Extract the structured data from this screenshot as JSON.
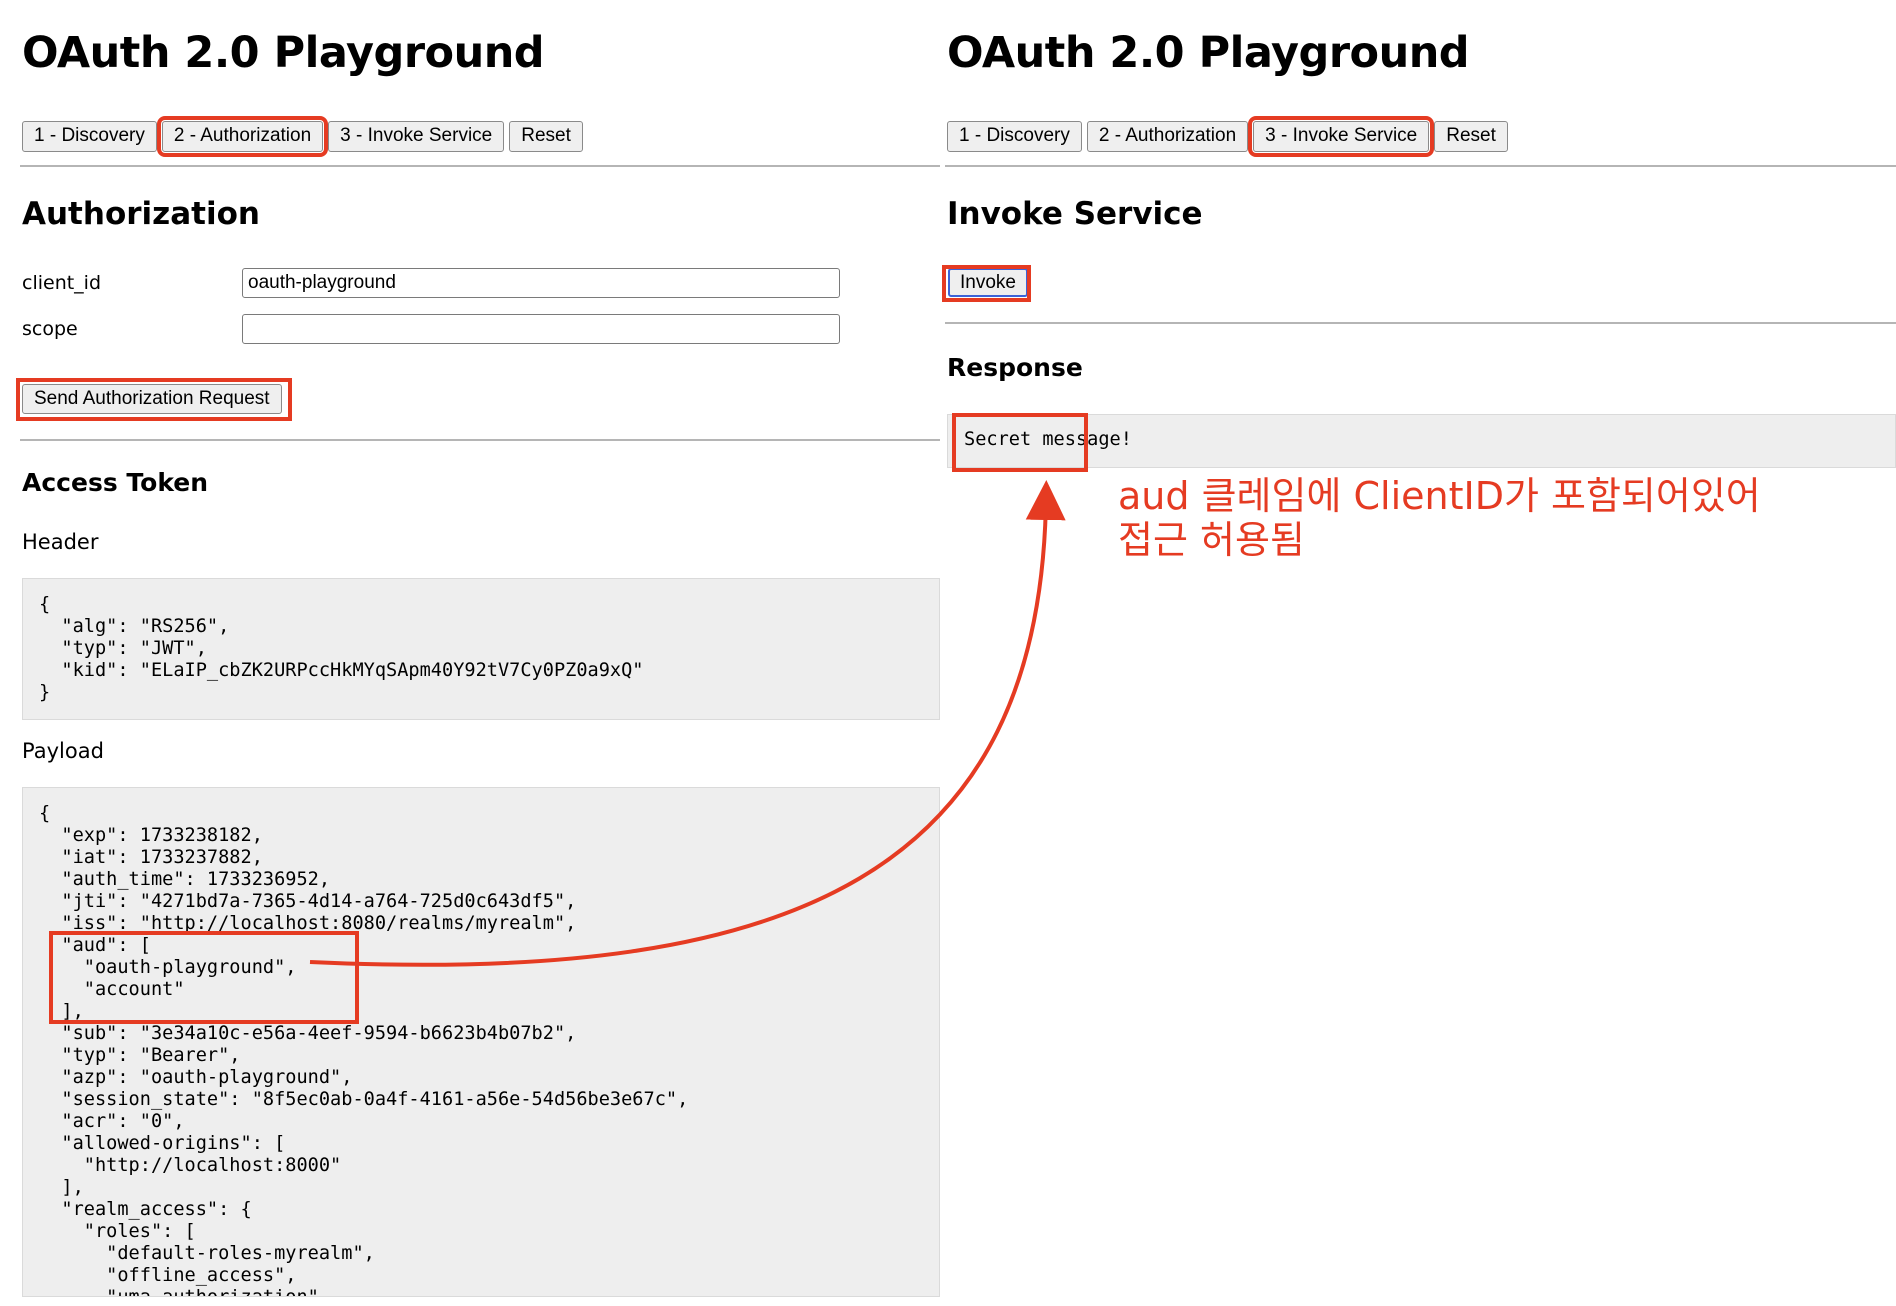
{
  "left": {
    "title": "OAuth 2.0 Playground",
    "tabs": [
      {
        "label": "1 - Discovery",
        "highlighted": false
      },
      {
        "label": "2 - Authorization",
        "highlighted": true
      },
      {
        "label": "3 - Invoke Service",
        "highlighted": false
      },
      {
        "label": "Reset",
        "highlighted": false
      }
    ],
    "section_title": "Authorization",
    "form": {
      "client_id_label": "client_id",
      "client_id_value": "oauth-playground",
      "scope_label": "scope",
      "scope_value": ""
    },
    "send_button_label": "Send Authorization Request",
    "access_token": {
      "title": "Access Token",
      "header_label": "Header",
      "header_json": "{\n  \"alg\": \"RS256\",\n  \"typ\": \"JWT\",\n  \"kid\": \"ELaIP_cbZK2URPccHkMYqSApm40Y92tV7Cy0PZ0a9xQ\"\n}",
      "payload_label": "Payload",
      "payload_json": "{\n  \"exp\": 1733238182,\n  \"iat\": 1733237882,\n  \"auth_time\": 1733236952,\n  \"jti\": \"4271bd7a-7365-4d14-a764-725d0c643df5\",\n  \"iss\": \"http://localhost:8080/realms/myrealm\",\n  \"aud\": [\n    \"oauth-playground\",\n    \"account\"\n  ],\n  \"sub\": \"3e34a10c-e56a-4eef-9594-b6623b4b07b2\",\n  \"typ\": \"Bearer\",\n  \"azp\": \"oauth-playground\",\n  \"session_state\": \"8f5ec0ab-0a4f-4161-a56e-54d56be3e67c\",\n  \"acr\": \"0\",\n  \"allowed-origins\": [\n    \"http://localhost:8000\"\n  ],\n  \"realm_access\": {\n    \"roles\": [\n      \"default-roles-myrealm\",\n      \"offline_access\",\n      \"uma_authorization\""
    }
  },
  "right": {
    "title": "OAuth 2.0 Playground",
    "tabs": [
      {
        "label": "1 - Discovery",
        "highlighted": false
      },
      {
        "label": "2 - Authorization",
        "highlighted": false
      },
      {
        "label": "3 - Invoke Service",
        "highlighted": true
      },
      {
        "label": "Reset",
        "highlighted": false
      }
    ],
    "section_title": "Invoke Service",
    "invoke_button_label": "Invoke",
    "response_title": "Response",
    "response_text": "Secret message!"
  },
  "annotation": {
    "text_line1": "aud 클레임에 ClientID가 포함되어있어",
    "text_line2": "접근 허용됨",
    "color": "#e53b22"
  }
}
